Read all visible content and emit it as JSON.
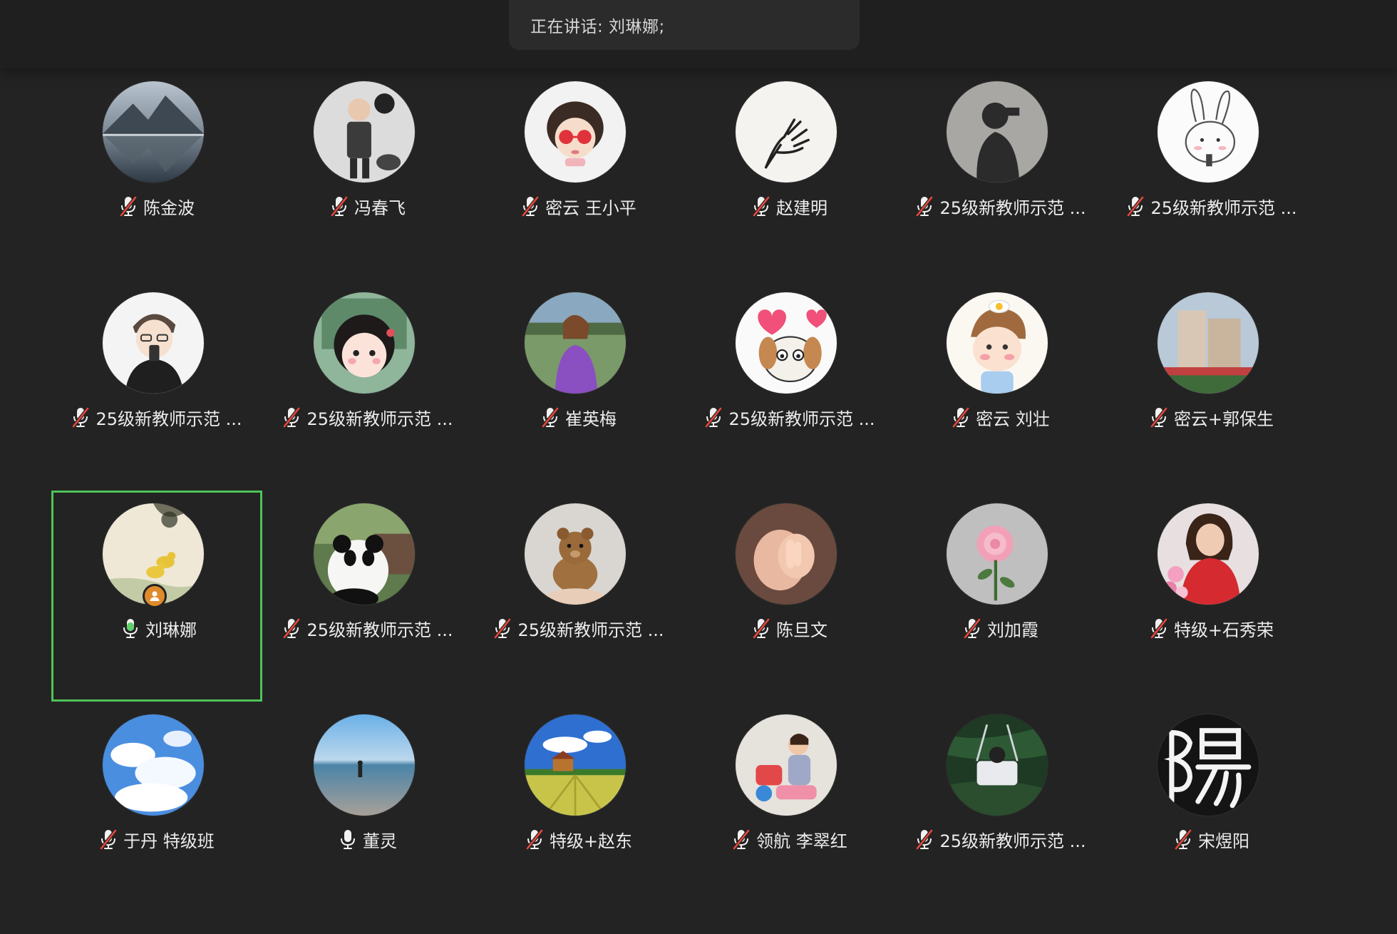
{
  "banner": {
    "speaking_text": "正在讲话: 刘琳娜;"
  },
  "colors": {
    "background": "#232323",
    "active_border": "#4ec35a",
    "muted_slash": "#e8463c",
    "unmuted_mic": "#5fd06a",
    "host_badge": "#e08a2c"
  },
  "participants": [
    {
      "name": "陈金波",
      "mic": "muted",
      "avatar": "mountain-lake-photo"
    },
    {
      "name": "冯春飞",
      "mic": "muted",
      "avatar": "child-in-suit-photo"
    },
    {
      "name": "密云 王小平",
      "mic": "muted",
      "avatar": "cartoon-girl-red-glasses"
    },
    {
      "name": "赵建明",
      "mic": "muted",
      "avatar": "hand-drawing"
    },
    {
      "name": "25级新教师示范 ...",
      "mic": "muted",
      "avatar": "shadow-silhouette"
    },
    {
      "name": "25级新教师示范 ...",
      "mic": "muted",
      "avatar": "rabbit-sketch"
    },
    {
      "name": "25级新教师示范 ...",
      "mic": "muted",
      "avatar": "cartoon-boy-phone"
    },
    {
      "name": "25级新教师示范 ...",
      "mic": "muted",
      "avatar": "cartoon-girl-chalkboard"
    },
    {
      "name": "崔英梅",
      "mic": "muted",
      "avatar": "woman-purple-outdoors"
    },
    {
      "name": "25级新教师示范 ...",
      "mic": "muted",
      "avatar": "cartoon-dog-hearts"
    },
    {
      "name": "密云 刘壮",
      "mic": "muted",
      "avatar": "cartoon-boy-egg"
    },
    {
      "name": "密云+郭保生",
      "mic": "muted",
      "avatar": "building-photo"
    },
    {
      "name": "刘琳娜",
      "mic": "speaking",
      "avatar": "ducks-painting",
      "active": true,
      "host": true
    },
    {
      "name": "25级新教师示范 ...",
      "mic": "muted",
      "avatar": "panda-photo"
    },
    {
      "name": "25级新教师示范 ...",
      "mic": "muted",
      "avatar": "bear-toy-photo"
    },
    {
      "name": "陈旦文",
      "mic": "muted",
      "avatar": "holding-hands-photo"
    },
    {
      "name": "刘加霞",
      "mic": "muted",
      "avatar": "pink-rose-photo"
    },
    {
      "name": "特级+石秀荣",
      "mic": "muted",
      "avatar": "woman-red-flowers"
    },
    {
      "name": "于丹 特级班",
      "mic": "muted",
      "avatar": "blue-sky-clouds"
    },
    {
      "name": "董灵",
      "mic": "on",
      "avatar": "beach-walker-photo"
    },
    {
      "name": "特级+赵东",
      "mic": "muted",
      "avatar": "field-house-photo"
    },
    {
      "name": "领航 李翠红",
      "mic": "muted",
      "avatar": "child-playing-photo"
    },
    {
      "name": "25级新教师示范 ...",
      "mic": "muted",
      "avatar": "swing-photo"
    },
    {
      "name": "宋煜阳",
      "mic": "muted",
      "avatar": "calligraphy-character"
    }
  ]
}
